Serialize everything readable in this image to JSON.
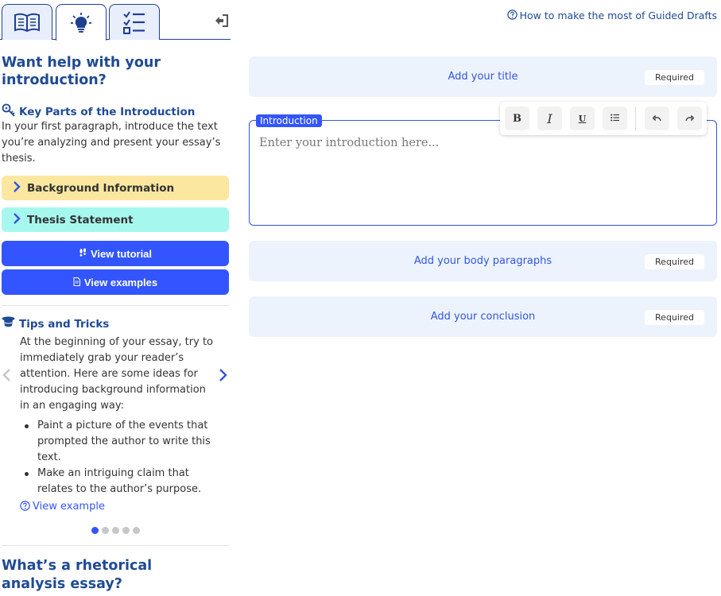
{
  "sidebar": {
    "tabs": [
      {
        "name": "book-tab",
        "icon": "book-icon"
      },
      {
        "name": "lightbulb-tab",
        "icon": "lightbulb-icon",
        "active": true
      },
      {
        "name": "checklist-tab",
        "icon": "checklist-icon"
      }
    ],
    "help_title": "Want help with your introduction?",
    "key_parts": {
      "heading": "Key Parts of the Introduction",
      "description": "In your first paragraph, introduce the text you’re analyzing and present your essay’s thesis."
    },
    "accordions": [
      {
        "label": "Background Information",
        "color": "#fbe7a0"
      },
      {
        "label": "Thesis Statement",
        "color": "#a6f8ee"
      }
    ],
    "buttons": {
      "tutorial": "View tutorial",
      "examples": "View examples"
    },
    "tips": {
      "heading": "Tips and Tricks",
      "body": "At the beginning of your essay, try to immediately grab your reader’s attention. Here are some ideas for introducing background information in an engaging way:",
      "bullets": [
        "Paint a picture of the events that prompted the author to write this text.",
        "Make an intriguing claim that relates to the author’s purpose."
      ],
      "view_example": "View example",
      "pages_total": 5,
      "current_page": 1
    },
    "rhetorical_title": "What’s a rhetorical analysis essay?"
  },
  "main": {
    "guide_link": "How to make the most of Guided Drafts",
    "title_card": {
      "label": "Add your title",
      "badge": "Required"
    },
    "introduction": {
      "label": "Introduction",
      "placeholder": "Enter your introduction here..."
    },
    "toolbar": {
      "bold": "B",
      "italic": "I",
      "underline": "U"
    },
    "body_card": {
      "label": "Add your body paragraphs",
      "badge": "Required"
    },
    "conclusion_card": {
      "label": "Add your conclusion",
      "badge": "Required"
    }
  },
  "colors": {
    "accent": "#3355ff",
    "heading": "#1f4a94",
    "card_bg": "#edf3fd"
  }
}
